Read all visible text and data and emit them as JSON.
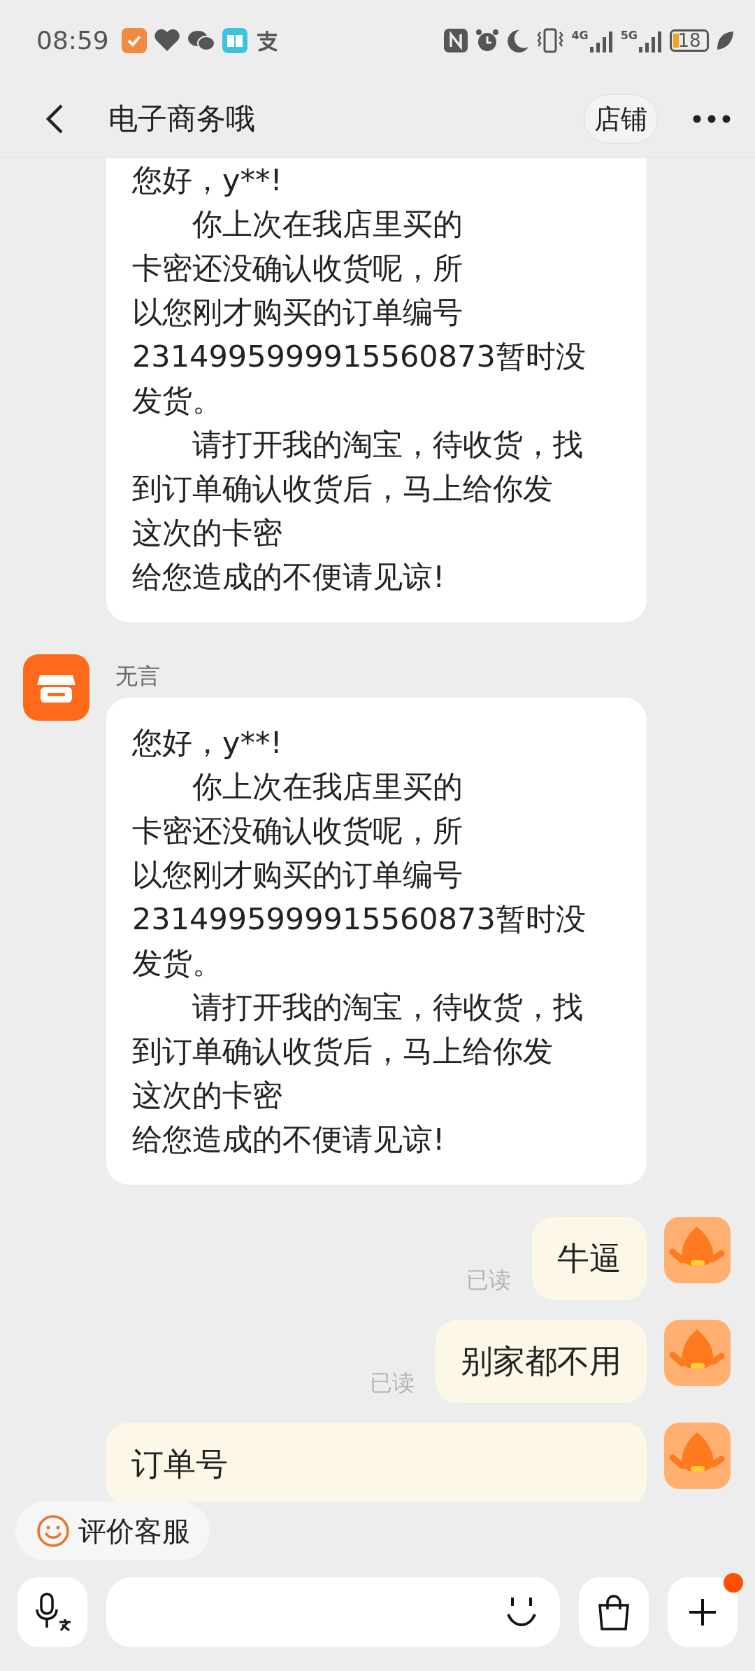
{
  "status_bar": {
    "time": "08:59",
    "network_1": "4G",
    "network_2": "5G",
    "battery": "18"
  },
  "header": {
    "title": "电子商务哦",
    "shop_button": "店铺"
  },
  "messages": [
    {
      "kind": "incoming",
      "lines": [
        "您好，y**!",
        "　　你上次在我店里买的",
        "卡密还没确认收货呢，所",
        "以您刚才购买的订单编号",
        "2314995999915560873暂时没",
        "发货。",
        "　　请打开我的淘宝，待收货，找",
        "到订单确认收货后，马上给你发",
        "这次的卡密",
        "给您造成的不便请见谅!"
      ]
    },
    {
      "kind": "incoming",
      "sender": "无言",
      "lines": [
        "您好，y**!",
        "　　你上次在我店里买的",
        "卡密还没确认收货呢，所",
        "以您刚才购买的订单编号",
        "2314995999915560873暂时没",
        "发货。",
        "　　请打开我的淘宝，待收货，找",
        "到订单确认收货后，马上给你发",
        "这次的卡密",
        "给您造成的不便请见谅!"
      ]
    },
    {
      "kind": "outgoing",
      "read_status": "已读",
      "lines": [
        "牛逼"
      ]
    },
    {
      "kind": "outgoing",
      "read_status": "已读",
      "lines": [
        "别家都不用"
      ]
    },
    {
      "kind": "order",
      "lines": [
        "订单号"
      ]
    }
  ],
  "rate_button": "评价客服",
  "input": {
    "has_notification": true
  }
}
